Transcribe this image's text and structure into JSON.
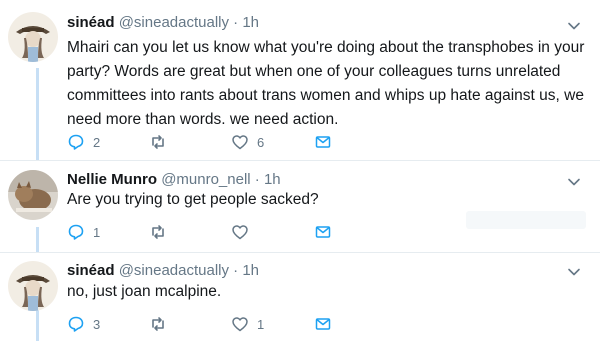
{
  "tweets": [
    {
      "name": "sinéad",
      "handle": "@sineadactually",
      "separator": "·",
      "time": "1h",
      "text": "Mhairi can you let us know what you're doing about the transphobes in your party?  Words are great but when one of your colleagues turns unrelated committees into rants about trans women and whips up hate against us, we need more than words. we need action.",
      "reply_count": "2",
      "retweet_count": "",
      "like_count": "6"
    },
    {
      "name": "Nellie Munro",
      "handle": "@munro_nell",
      "separator": "·",
      "time": "1h",
      "text": "Are you trying to get people sacked?",
      "reply_count": "1",
      "retweet_count": "",
      "like_count": ""
    },
    {
      "name": "sinéad",
      "handle": "@sineadactually",
      "separator": "·",
      "time": "1h",
      "text": "no, just joan mcalpine.",
      "reply_count": "3",
      "retweet_count": "",
      "like_count": "1"
    }
  ],
  "colors": {
    "text": "#14171a",
    "muted": "#657786",
    "thread_line": "#c7dff5",
    "divider": "#e6ecf0",
    "accent": "#1da1f2"
  },
  "icons": [
    "reply-icon",
    "retweet-icon",
    "like-icon",
    "direct-message-icon",
    "chevron-down-icon"
  ]
}
